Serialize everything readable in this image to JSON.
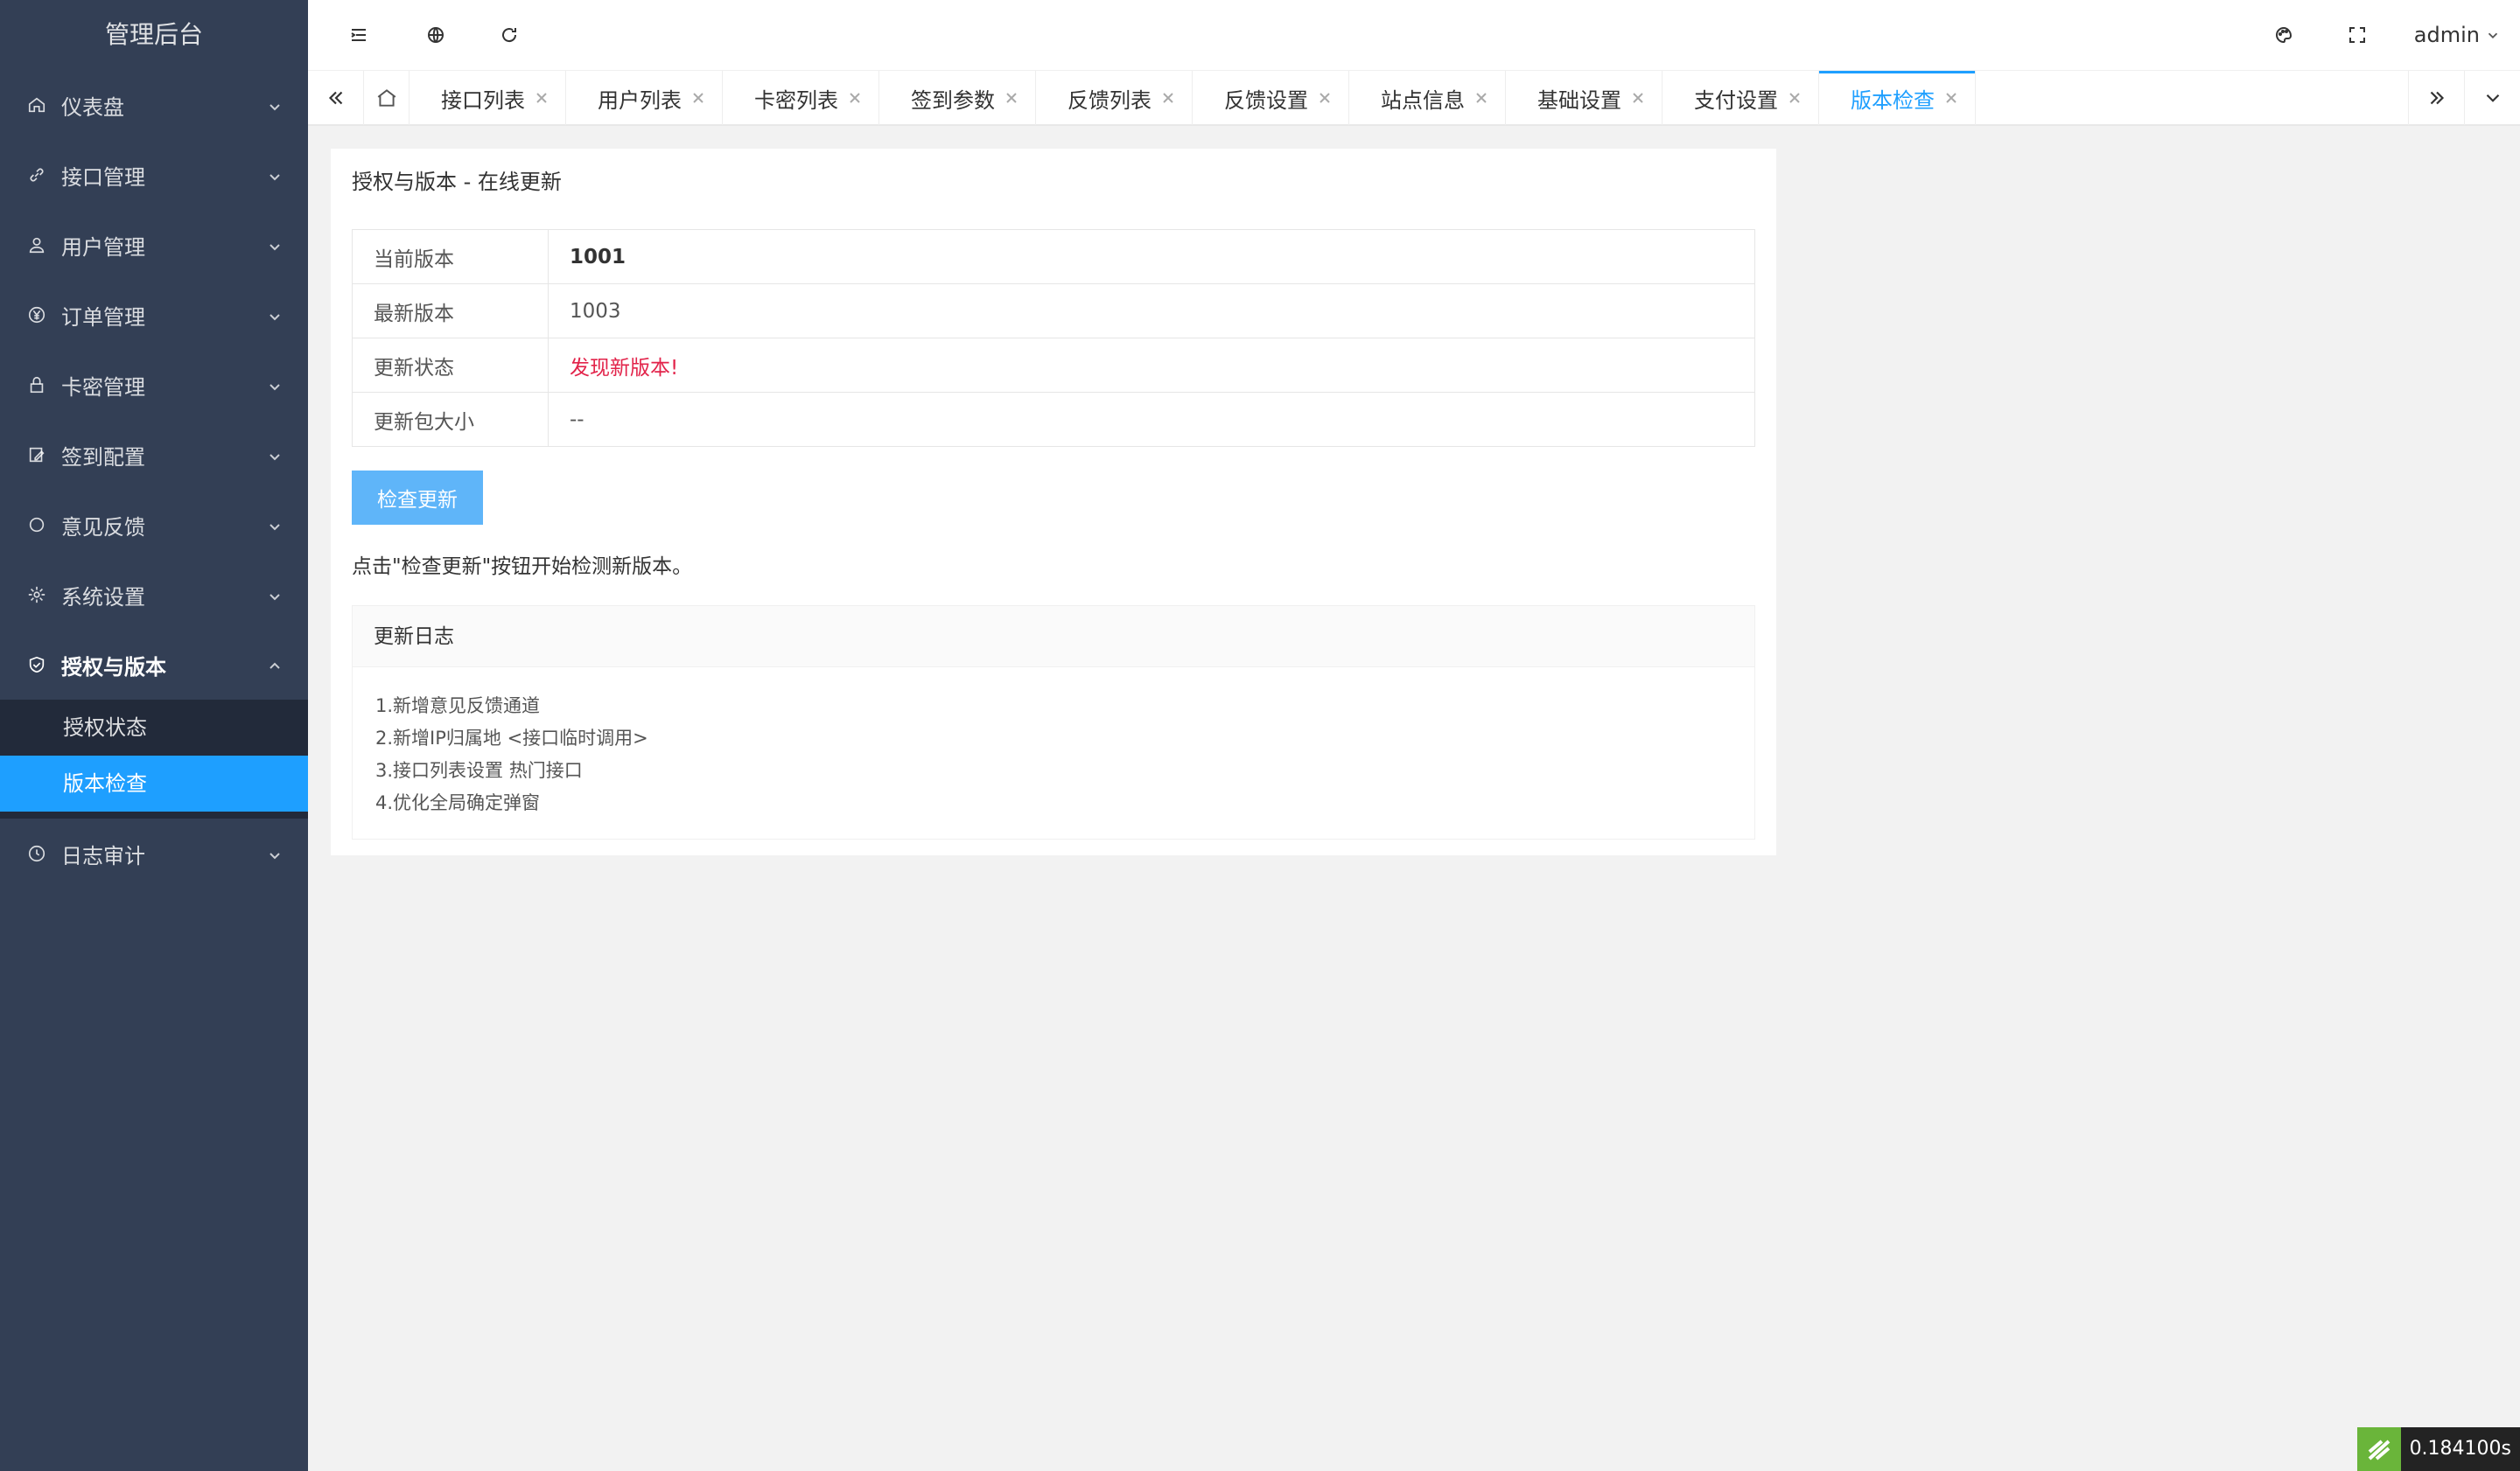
{
  "app": {
    "title": "管理后台"
  },
  "sidebar": {
    "items": [
      {
        "label": "仪表盘",
        "icon": "home-icon"
      },
      {
        "label": "接口管理",
        "icon": "link-icon"
      },
      {
        "label": "用户管理",
        "icon": "user-icon"
      },
      {
        "label": "订单管理",
        "icon": "yen-icon"
      },
      {
        "label": "卡密管理",
        "icon": "lock-icon"
      },
      {
        "label": "签到配置",
        "icon": "edit-icon"
      },
      {
        "label": "意见反馈",
        "icon": "circle-icon"
      },
      {
        "label": "系统设置",
        "icon": "gear-icon"
      },
      {
        "label": "授权与版本",
        "icon": "shield-icon",
        "submenu": [
          {
            "label": "授权状态"
          },
          {
            "label": "版本检查"
          }
        ]
      },
      {
        "label": "日志审计",
        "icon": "clock-icon"
      }
    ]
  },
  "header": {
    "user": "admin"
  },
  "tabs": [
    {
      "label": "接口列表"
    },
    {
      "label": "用户列表"
    },
    {
      "label": "卡密列表"
    },
    {
      "label": "签到参数"
    },
    {
      "label": "反馈列表"
    },
    {
      "label": "反馈设置"
    },
    {
      "label": "站点信息"
    },
    {
      "label": "基础设置"
    },
    {
      "label": "支付设置"
    },
    {
      "label": "版本检查"
    }
  ],
  "main": {
    "title": "授权与版本 - 在线更新",
    "rows": [
      {
        "key": "当前版本",
        "value": "1001"
      },
      {
        "key": "最新版本",
        "value": "1003"
      },
      {
        "key": "更新状态",
        "value": "发现新版本!"
      },
      {
        "key": "更新包大小",
        "value": "--"
      }
    ],
    "check_button": "检查更新",
    "tip": "点击\"检查更新\"按钮开始检测新版本。",
    "log": {
      "title": "更新日志",
      "lines": [
        "1.新增意见反馈通道",
        "2.新增IP归属地 <接口临时调用>",
        "3.接口列表设置 热门接口",
        "4.优化全局确定弹窗"
      ]
    }
  },
  "timer": {
    "text": "0.184100s"
  },
  "colors": {
    "sidebar": "#333f55",
    "accent": "#1e9fff",
    "button": "#5fb5f9",
    "alert": "#e2234a"
  }
}
